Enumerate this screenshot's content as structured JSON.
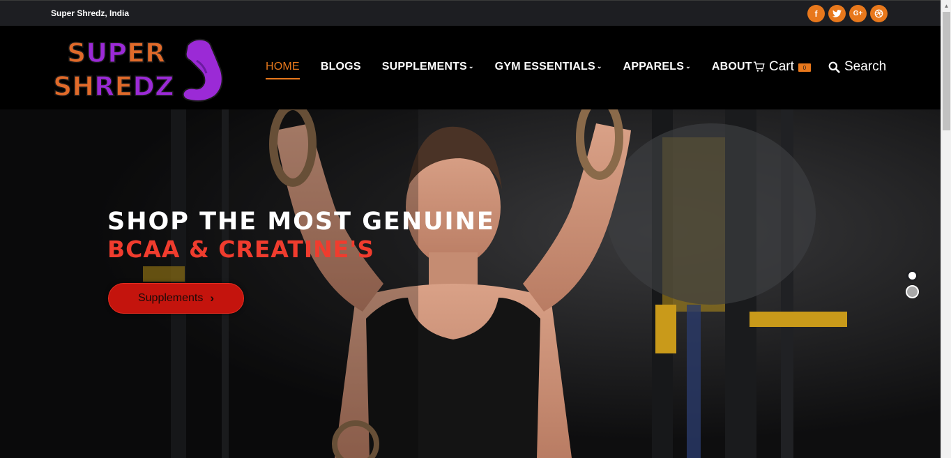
{
  "topbar": {
    "location": "Super Shredz, India",
    "social": [
      {
        "icon": "facebook-icon",
        "glyph": "f"
      },
      {
        "icon": "twitter-icon",
        "glyph": "t"
      },
      {
        "icon": "google-plus-icon",
        "glyph": "G+"
      },
      {
        "icon": "dribbble-icon",
        "glyph": "◎"
      }
    ],
    "accent": "#e8781c"
  },
  "logo": {
    "line1": "SUPER",
    "line2": "SHREDZ",
    "colors": {
      "orange": "#e06a2a",
      "purple": "#9b2ad6"
    }
  },
  "nav": {
    "home": "HOME",
    "blogs": "BLOGS",
    "supplements": "SUPPLEMENTS",
    "gym_essentials": "GYM ESSENTIALS",
    "apparels": "APPARELS",
    "about": "ABOUT",
    "active": "HOME"
  },
  "cart": {
    "label": "Cart",
    "count": "0"
  },
  "search": {
    "label": "Search"
  },
  "hero": {
    "title_line1": "SHOP THE MOST GENUINE",
    "title_line2": "BCAA & CREATINE'S",
    "button_label": "Supplements",
    "slide_count": 2,
    "active_slide": 1,
    "colors": {
      "highlight": "#f03c2e",
      "button": "#c4140d"
    }
  }
}
